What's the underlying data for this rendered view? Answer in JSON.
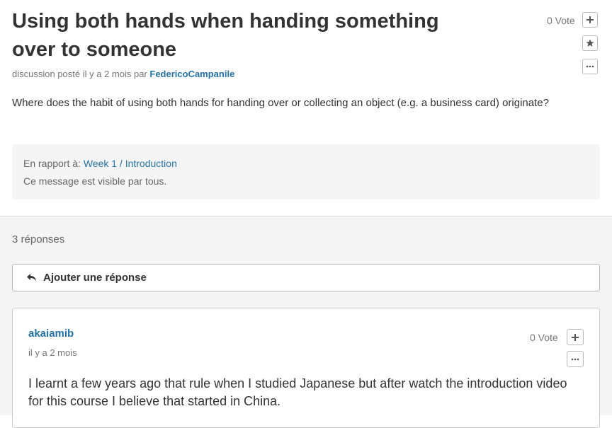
{
  "post": {
    "title": "Using both hands when handing something over to someone",
    "meta_prefix": "discussion posté il y a 2 mois par ",
    "author": "FedericoCampanile",
    "vote_label": "0 Vote",
    "body": "Where does the habit of using both hands for handing over or collecting an object (e.g. a business card) originate?",
    "context": {
      "label": "En rapport à: ",
      "link": "Week 1 / Introduction",
      "visibility": "Ce message est visible par tous."
    }
  },
  "responses": {
    "count_label": "3 réponses",
    "add_label": "Ajouter une réponse",
    "items": [
      {
        "author": "akaiamib",
        "time": "il y a 2 mois",
        "vote_label": "0 Vote",
        "body": "I learnt a few years ago that rule when I studied Japanese but after watch the introduction video for this course I believe that started in China."
      }
    ]
  },
  "icons": {
    "vote": "plus-icon",
    "follow": "star-icon",
    "more": "ellipsis-icon",
    "reply": "reply-arrow-icon"
  },
  "colors": {
    "link": "#2473a8",
    "background_responses": "#f4f4f4",
    "context_box": "#f5f5f5"
  }
}
